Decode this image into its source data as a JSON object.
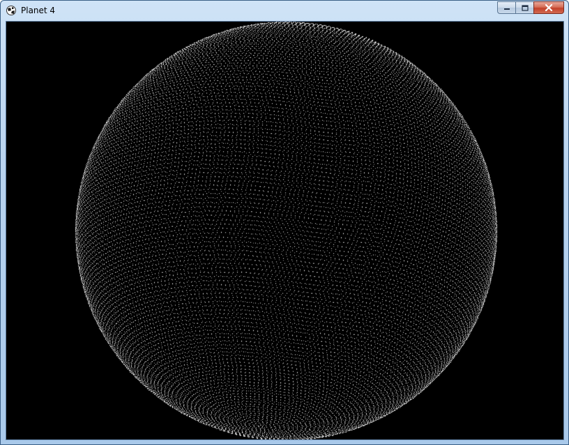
{
  "window": {
    "title": "Planet 4",
    "icon": "app-globe-icon",
    "caption_buttons": [
      {
        "name": "minimize",
        "icon": "minimize-icon"
      },
      {
        "name": "maximize",
        "icon": "maximize-icon"
      },
      {
        "name": "close",
        "icon": "close-icon"
      }
    ]
  },
  "scene": {
    "background_color": "#000000",
    "point_color": "#ffffff",
    "description_kind": "dotted-sphere"
  }
}
